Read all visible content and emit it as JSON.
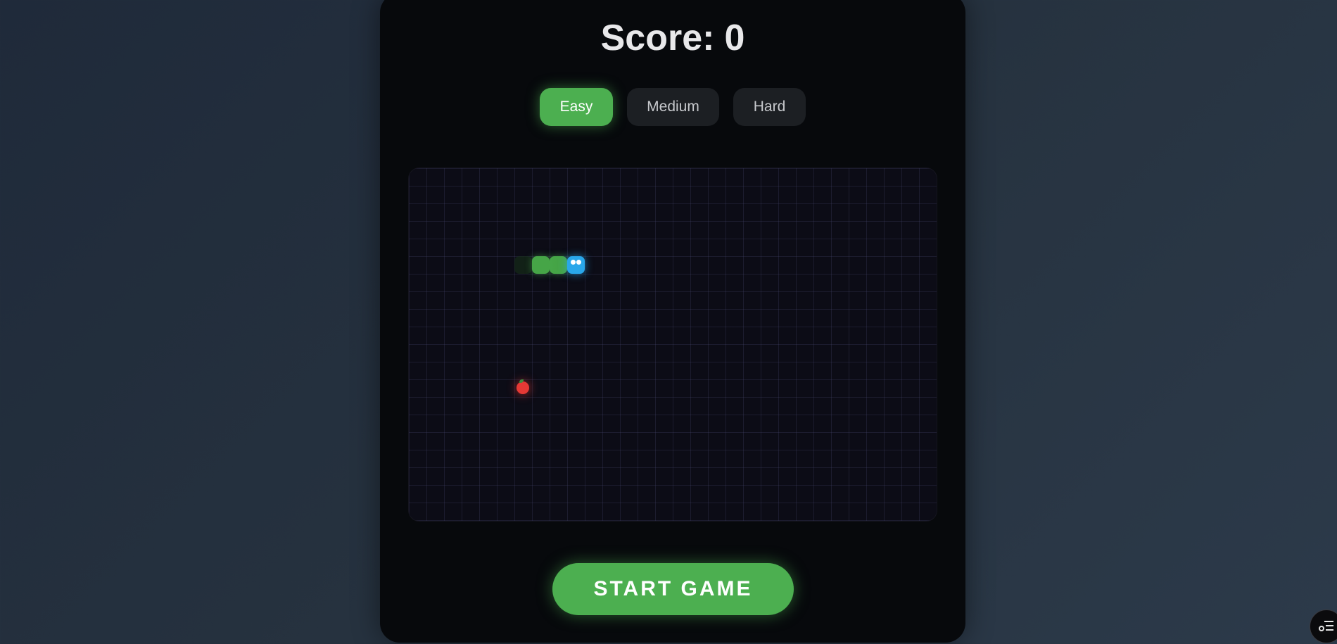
{
  "score": {
    "label": "Score:",
    "value": "0"
  },
  "difficulty": {
    "options": [
      "Easy",
      "Medium",
      "Hard"
    ],
    "selected": "Easy"
  },
  "game": {
    "grid": {
      "cols": 30,
      "rows": 20
    },
    "snake": {
      "head": {
        "col": 9,
        "row": 5
      },
      "body": [
        {
          "col": 8,
          "row": 5
        },
        {
          "col": 7,
          "row": 5
        }
      ],
      "fading_tail": {
        "col": 6,
        "row": 5
      },
      "direction": "right"
    },
    "food": {
      "col": 6,
      "row": 12,
      "icon": "apple-icon"
    }
  },
  "actions": {
    "start_label": "START GAME"
  },
  "overlay": {
    "icon": "settings-list-icon"
  },
  "colors": {
    "accent": "#4caf50",
    "snake_head": "#29a7ea",
    "food": "#e53935",
    "panel": "#07090c"
  }
}
